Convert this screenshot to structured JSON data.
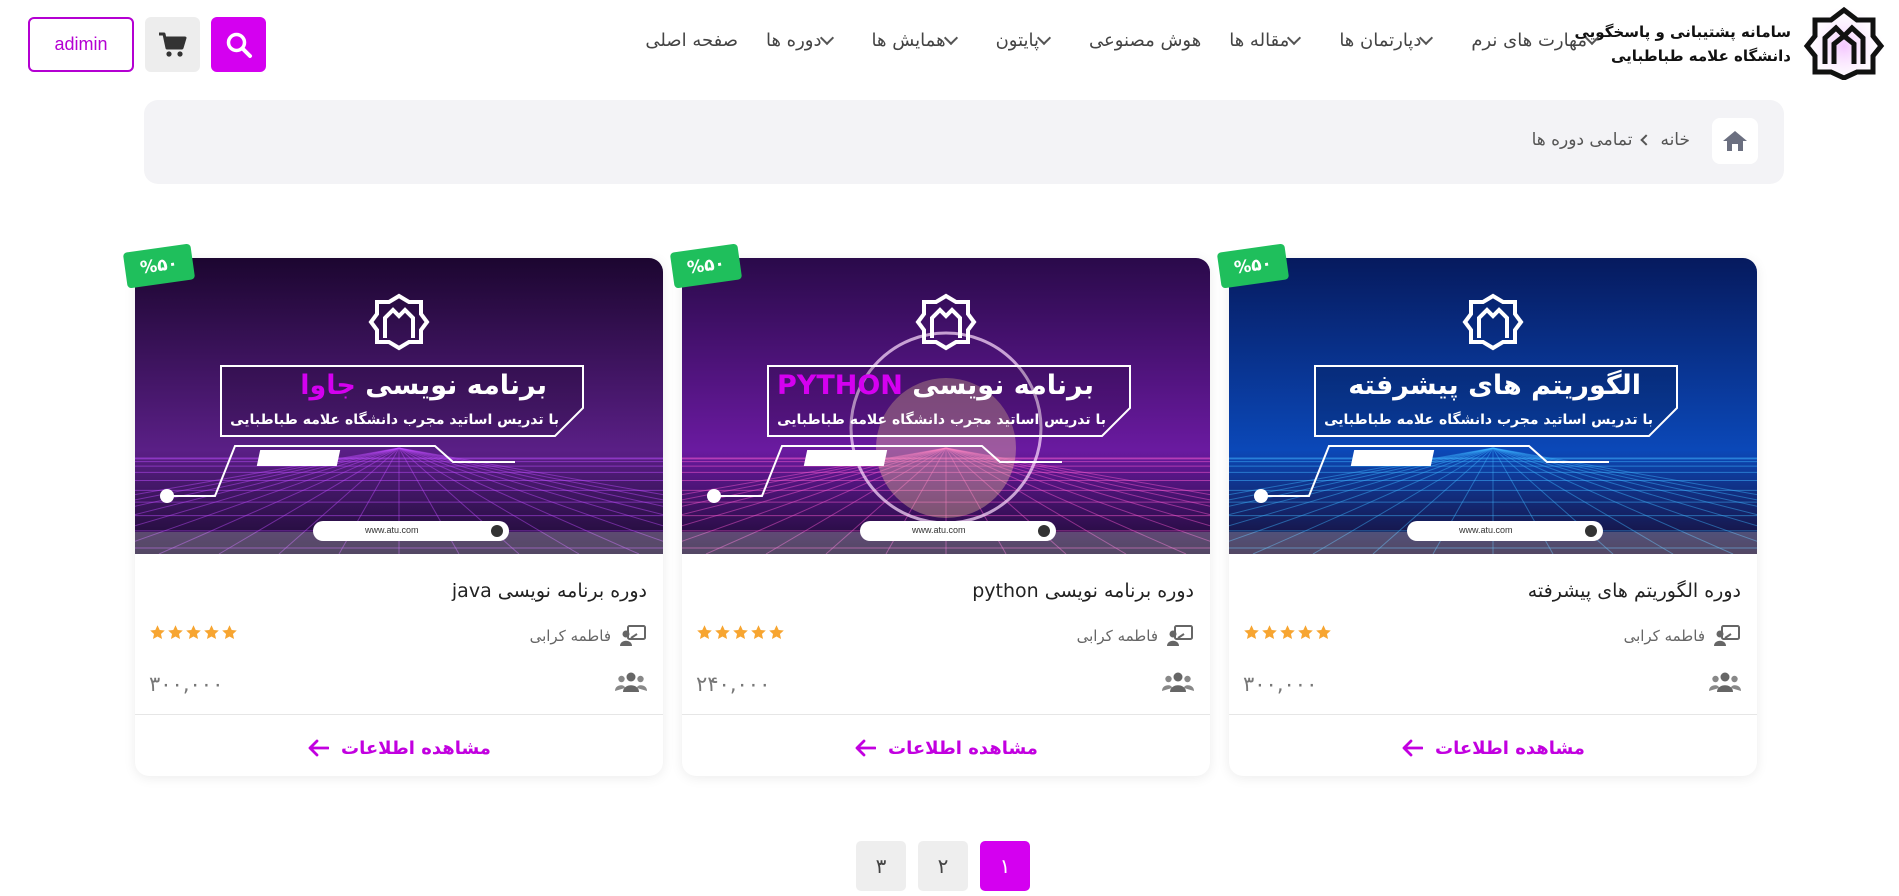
{
  "brand": {
    "title_line1": "سامانه پشتیبانی و پاسخگویی",
    "title_line2": "دانشگاه علامه طباطبایی"
  },
  "nav": [
    {
      "label": "صفحه اصلی",
      "dropdown": false
    },
    {
      "label": "دوره ها",
      "dropdown": true
    },
    {
      "label": "همایش ها",
      "dropdown": true
    },
    {
      "label": "پایتون",
      "dropdown": true
    },
    {
      "label": "هوش مصنوعی",
      "dropdown": false
    },
    {
      "label": "مقاله ها",
      "dropdown": true
    },
    {
      "label": "دپارتمان ها",
      "dropdown": true
    },
    {
      "label": "مهارت های نرم",
      "dropdown": true
    }
  ],
  "header": {
    "user_label": "adimin",
    "search_icon": "search-icon",
    "cart_icon": "cart-icon"
  },
  "breadcrumb": {
    "home": "خانه",
    "current": "تمامی دوره ها"
  },
  "colors": {
    "accent": "#d400f0",
    "discount": "#1fbf5c",
    "star": "#f7a531"
  },
  "cards": [
    {
      "discount": "%۵۰",
      "banner_title": "الگوریتم های پیشرفته",
      "banner_highlight": "",
      "banner_subtitle": "با تدریس اساتید مجرب دانشگاه علامه طباطبایی",
      "banner_url": "www.atu.com",
      "title": "دوره الگوریتم های پیشرفته",
      "teacher": "فاطمه کرابی",
      "rating": 5,
      "price": "۳۰۰,۰۰۰",
      "cta": "مشاهده اطلاعات"
    },
    {
      "discount": "%۵۰",
      "banner_title": "برنامه نویسی",
      "banner_highlight": "PYTHON",
      "banner_subtitle": "با تدریس اساتید مجرب دانشگاه علامه طباطبایی",
      "banner_url": "www.atu.com",
      "title": "دوره برنامه نویسی python",
      "teacher": "فاطمه کرابی",
      "rating": 5,
      "price": "۲۴۰,۰۰۰",
      "cta": "مشاهده اطلاعات"
    },
    {
      "discount": "%۵۰",
      "banner_title": "برنامه نویسی",
      "banner_highlight": "جاوا",
      "banner_subtitle": "با تدریس اساتید مجرب دانشگاه علامه طباطبایی",
      "banner_url": "www.atu.com",
      "title": "دوره برنامه نویسی java",
      "teacher": "فاطمه کرابی",
      "rating": 5,
      "price": "۳۰۰,۰۰۰",
      "cta": "مشاهده اطلاعات"
    }
  ],
  "pagination": {
    "pages": [
      "۱",
      "۲",
      "۳"
    ],
    "current": "۱"
  }
}
